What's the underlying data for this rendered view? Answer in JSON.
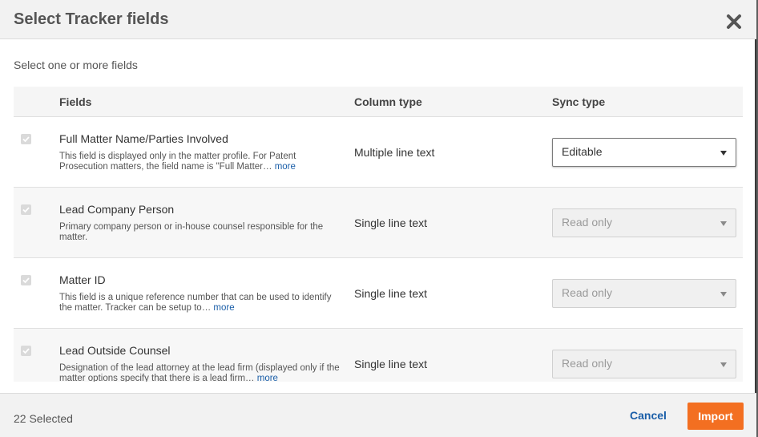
{
  "dialog": {
    "title": "Select Tracker fields",
    "subtitle": "Select one or more fields"
  },
  "table": {
    "headers": {
      "fields": "Fields",
      "column_type": "Column type",
      "sync_type": "Sync type"
    },
    "rows": [
      {
        "checked": true,
        "name": "Full Matter Name/Parties Involved",
        "description": "This field is displayed only in the matter profile. For Patent Prosecution matters, the field name is \"Full Matter…",
        "more": "more",
        "column_type": "Multiple line text",
        "sync_type": "Editable",
        "sync_editable": true
      },
      {
        "checked": true,
        "name": "Lead Company Person",
        "description": "Primary company person or in-house counsel responsible for the matter.",
        "more": "",
        "column_type": "Single line text",
        "sync_type": "Read only",
        "sync_editable": false
      },
      {
        "checked": true,
        "name": "Matter ID",
        "description": "This field is a unique reference number that can be used to identify the matter. Tracker can be setup to…",
        "more": "more",
        "column_type": "Single line text",
        "sync_type": "Read only",
        "sync_editable": false
      },
      {
        "checked": true,
        "name": "Lead Outside Counsel",
        "description": "Designation of the lead attorney at the lead firm (displayed only if the matter options specify that there is a lead firm…",
        "more": "more",
        "column_type": "Single line text",
        "sync_type": "Read only",
        "sync_editable": false
      }
    ]
  },
  "footer": {
    "selected_count": "22 Selected",
    "cancel_label": "Cancel",
    "import_label": "Import"
  },
  "icons": {
    "close": "close-icon",
    "checkbox": "checkmark-icon",
    "dropdown": "chevron-down-icon"
  },
  "colors": {
    "accent": "#f36f21",
    "link": "#1a5ea8"
  }
}
